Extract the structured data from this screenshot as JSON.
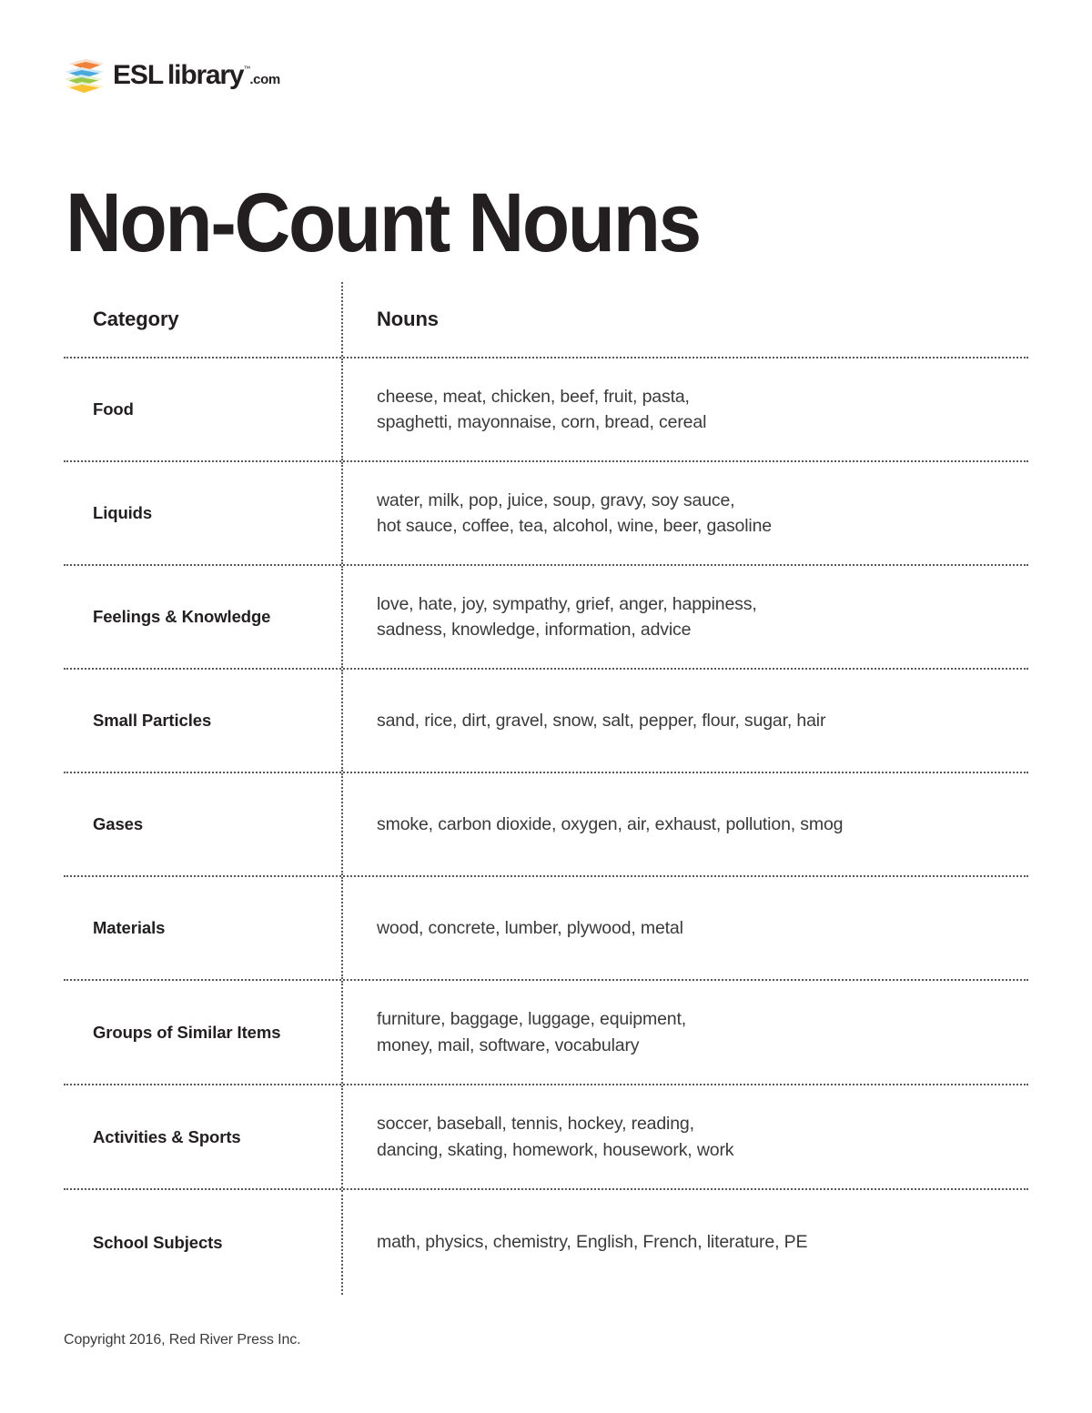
{
  "brand": {
    "logo_icon": "stacked-books-icon",
    "name_bold": "ESL",
    "name_regular": "library",
    "trademark": "™",
    "tld": ".com",
    "colors": {
      "book_top": "#f0823c",
      "book_blue": "#4aa9dd",
      "book_green": "#9ac94a",
      "book_yellow": "#f9c22e",
      "wordmark": "#231f20"
    }
  },
  "title": "Non-Count Nouns",
  "table": {
    "columns": [
      "Category",
      "Nouns"
    ],
    "rows": [
      {
        "category": "Food",
        "nouns": "cheese, meat, chicken, beef, fruit, pasta,\nspaghetti, mayonnaise, corn, bread, cereal"
      },
      {
        "category": "Liquids",
        "nouns": "water, milk, pop, juice, soup, gravy, soy sauce,\nhot sauce, coffee, tea, alcohol, wine, beer, gasoline"
      },
      {
        "category": "Feelings & Knowledge",
        "nouns": "love, hate, joy, sympathy, grief, anger, happiness,\nsadness, knowledge, information, advice"
      },
      {
        "category": "Small Particles",
        "nouns": "sand, rice, dirt, gravel, snow, salt, pepper, flour, sugar, hair"
      },
      {
        "category": "Gases",
        "nouns": "smoke, carbon dioxide, oxygen, air, exhaust, pollution, smog"
      },
      {
        "category": "Materials",
        "nouns": "wood, concrete, lumber, plywood, metal"
      },
      {
        "category": "Groups of Similar Items",
        "nouns": "furniture, baggage, luggage, equipment,\nmoney, mail, software, vocabulary"
      },
      {
        "category": "Activities & Sports",
        "nouns": "soccer, baseball, tennis, hockey, reading,\ndancing, skating, homework, housework, work"
      },
      {
        "category": "School Subjects",
        "nouns": "math, physics, chemistry, English, French, literature, PE"
      }
    ]
  },
  "footer": {
    "copyright": "Copyright 2016, Red River Press Inc."
  }
}
